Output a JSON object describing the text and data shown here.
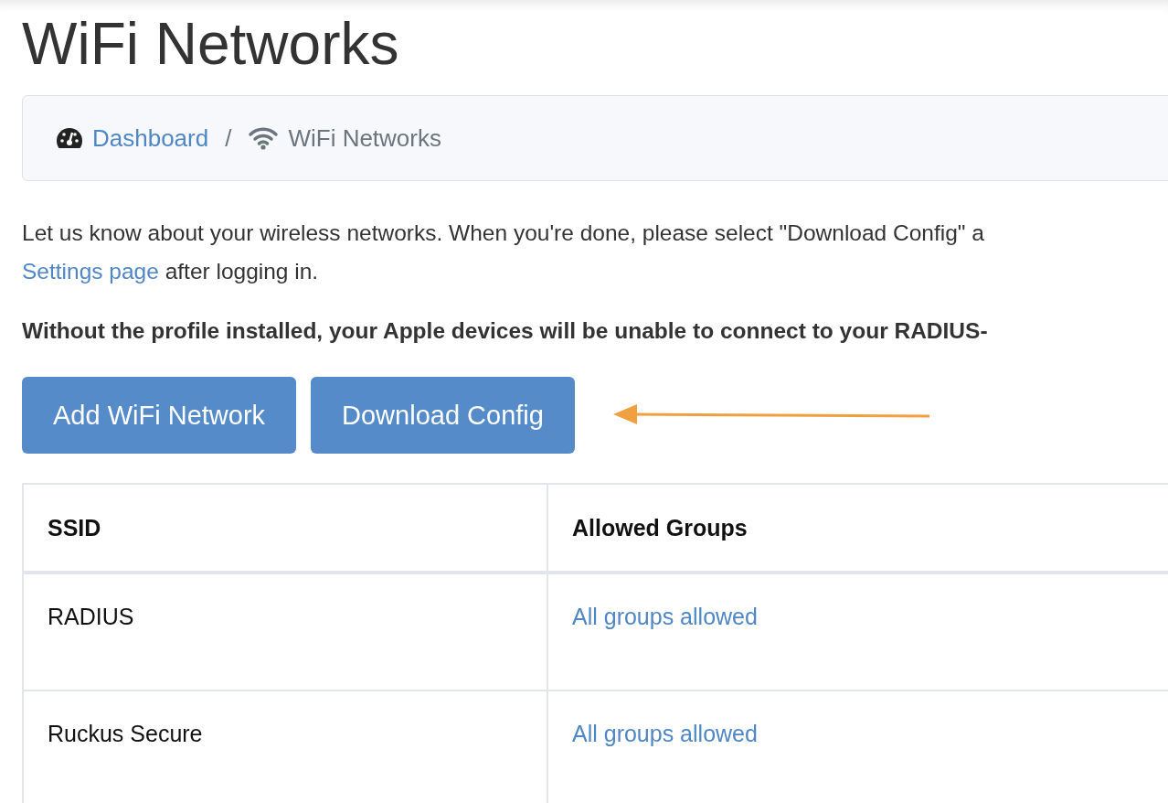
{
  "title": "WiFi Networks",
  "breadcrumb": [
    {
      "label": "Dashboard",
      "kind": "link"
    },
    {
      "label": "WiFi Networks",
      "kind": "current"
    }
  ],
  "breadcrumb_separator": "/",
  "intro": {
    "text": "Let us know about your wireless networks. When you're done, please select \"Download Config\" a",
    "link": "Settings page",
    "after": " after logging in."
  },
  "warning": "Without the profile installed, your Apple devices will be unable to connect to your RADIUS-",
  "buttons": [
    "Add WiFi Network",
    "Download Config"
  ],
  "table": {
    "columns": [
      "SSID",
      "Allowed Groups"
    ],
    "rows": [
      {
        "ssid": "RADIUS",
        "groups": "All groups allowed"
      },
      {
        "ssid": "Ruckus Secure",
        "groups": "All groups allowed"
      }
    ]
  }
}
